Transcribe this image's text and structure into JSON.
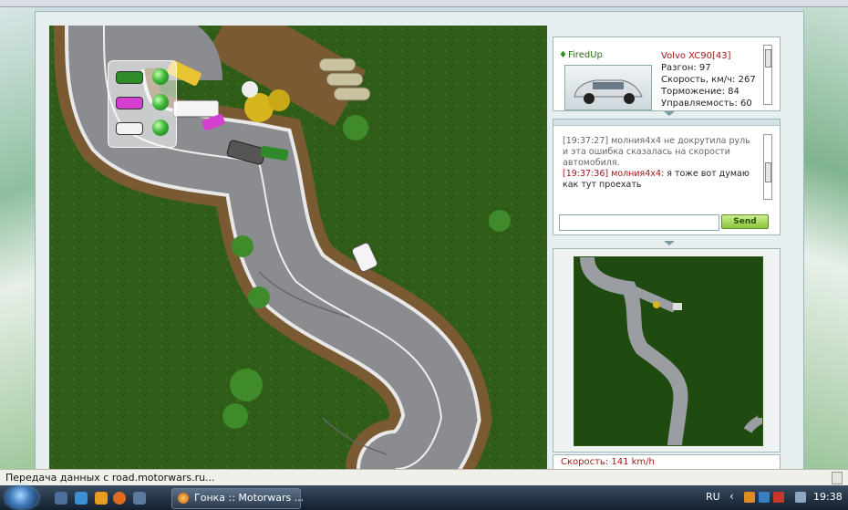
{
  "player": {
    "name": "FiredUp",
    "car_model": "Volvo XC90[43]",
    "stats": [
      "Разгон: 97",
      "Скорость, км/ч: 267",
      "Торможение: 84",
      "Управляемость: 60"
    ]
  },
  "chat": {
    "messages": [
      {
        "time": "[19:37:27]",
        "text": "молния4х4 не докрутила руль и эта ошибка сказалась на скорости автомобиля."
      },
      {
        "time": "[19:37:36]",
        "user": "молния4х4:",
        "text": "я тоже вот думаю как тут проехать"
      }
    ],
    "input_value": "",
    "send_label": "Send"
  },
  "speed_readout": "Скорость: 141 km/h",
  "car_status": [
    {
      "color": "#2f8a2a"
    },
    {
      "color": "#d43fd0"
    },
    {
      "color": "#f2f2f2"
    }
  ],
  "statusbar": {
    "text": "Передача данных с road.motorwars.ru..."
  },
  "taskbar": {
    "window_title": "Гонка :: Motorwars ...",
    "language": "RU",
    "clock": "19:38"
  }
}
